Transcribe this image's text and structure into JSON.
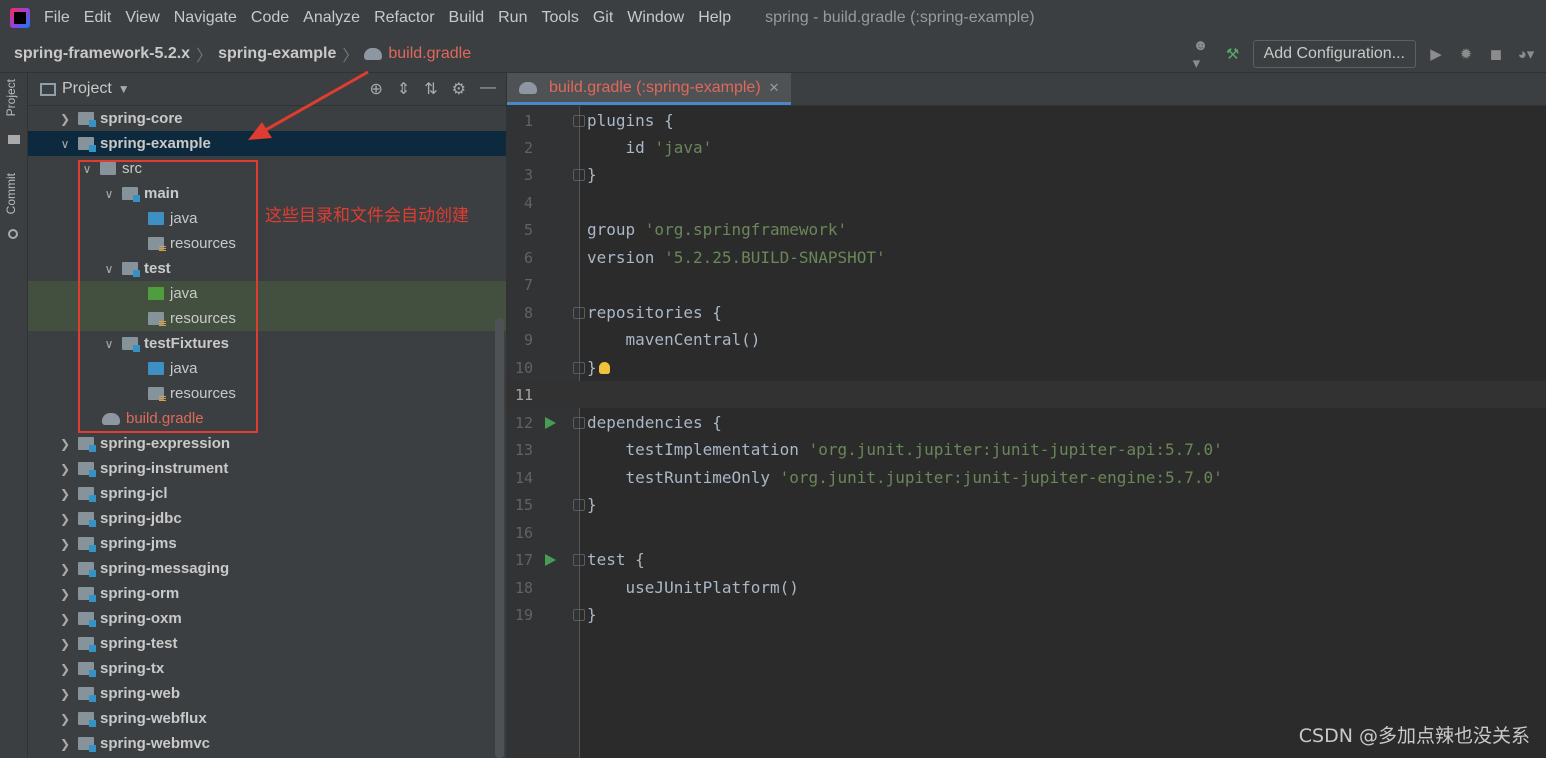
{
  "menu": {
    "items": [
      "File",
      "Edit",
      "View",
      "Navigate",
      "Code",
      "Analyze",
      "Refactor",
      "Build",
      "Run",
      "Tools",
      "Git",
      "Window",
      "Help"
    ],
    "window_title": "spring - build.gradle (:spring-example)"
  },
  "navbar": {
    "crumbs": [
      "spring-framework-5.2.x",
      "spring-example"
    ],
    "file": "build.gradle",
    "add_config": "Add Configuration..."
  },
  "sidebar": {
    "project_label": "Project",
    "commit_label": "Commit"
  },
  "project_pane": {
    "title": "Project",
    "tree": [
      {
        "label": "spring-core"
      },
      {
        "label": "spring-example"
      },
      {
        "label": "src"
      },
      {
        "label": "main"
      },
      {
        "label": "java"
      },
      {
        "label": "resources"
      },
      {
        "label": "test"
      },
      {
        "label": "java"
      },
      {
        "label": "resources"
      },
      {
        "label": "testFixtures"
      },
      {
        "label": "java"
      },
      {
        "label": "resources"
      },
      {
        "label": "build.gradle"
      },
      {
        "label": "spring-expression"
      },
      {
        "label": "spring-instrument"
      },
      {
        "label": "spring-jcl"
      },
      {
        "label": "spring-jdbc"
      },
      {
        "label": "spring-jms"
      },
      {
        "label": "spring-messaging"
      },
      {
        "label": "spring-orm"
      },
      {
        "label": "spring-oxm"
      },
      {
        "label": "spring-test"
      },
      {
        "label": "spring-tx"
      },
      {
        "label": "spring-web"
      },
      {
        "label": "spring-webflux"
      },
      {
        "label": "spring-webmvc"
      }
    ]
  },
  "annotation": {
    "text": "这些目录和文件会自动创建"
  },
  "editor": {
    "tab_label": "build.gradle (:spring-example)",
    "lines": [
      {
        "num": "1",
        "code": "plugins {",
        "str": ""
      },
      {
        "num": "2",
        "code": "    id ",
        "str": "'java'"
      },
      {
        "num": "3",
        "code": "}",
        "str": ""
      },
      {
        "num": "4",
        "code": "",
        "str": ""
      },
      {
        "num": "5",
        "code": "group ",
        "str": "'org.springframework'"
      },
      {
        "num": "6",
        "code": "version ",
        "str": "'5.2.25.BUILD-SNAPSHOT'"
      },
      {
        "num": "7",
        "code": "",
        "str": ""
      },
      {
        "num": "8",
        "code": "repositories {",
        "str": ""
      },
      {
        "num": "9",
        "code": "    mavenCentral()",
        "str": ""
      },
      {
        "num": "10",
        "code": "}",
        "str": ""
      },
      {
        "num": "11",
        "code": "",
        "str": ""
      },
      {
        "num": "12",
        "code": "dependencies {",
        "str": ""
      },
      {
        "num": "13",
        "code": "    testImplementation ",
        "str": "'org.junit.jupiter:junit-jupiter-api:5.7.0'"
      },
      {
        "num": "14",
        "code": "    testRuntimeOnly ",
        "str": "'org.junit.jupiter:junit-jupiter-engine:5.7.0'"
      },
      {
        "num": "15",
        "code": "}",
        "str": ""
      },
      {
        "num": "16",
        "code": "",
        "str": ""
      },
      {
        "num": "17",
        "code": "test {",
        "str": ""
      },
      {
        "num": "18",
        "code": "    useJUnitPlatform()",
        "str": ""
      },
      {
        "num": "19",
        "code": "}",
        "str": ""
      }
    ]
  },
  "watermark": "CSDN @多加点辣也没关系"
}
